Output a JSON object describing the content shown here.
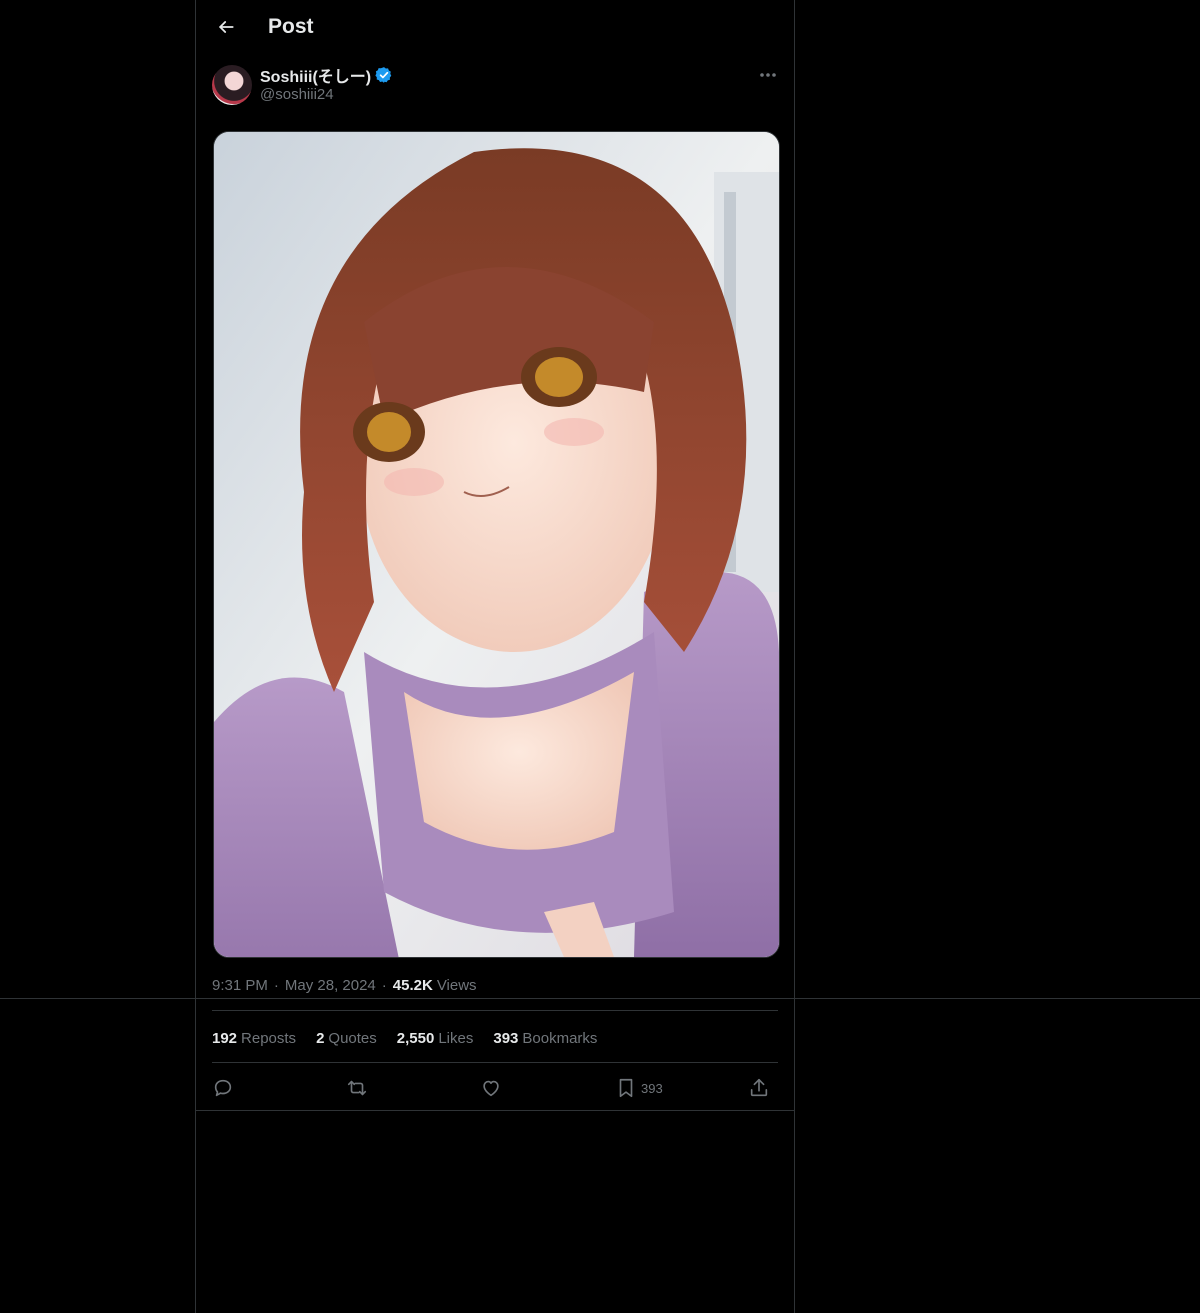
{
  "header": {
    "title": "Post",
    "back_icon": "arrow-left-icon"
  },
  "author": {
    "name": "Soshiii(そしー)",
    "handle": "@soshiii24",
    "verified_icon": "verified-badge-icon",
    "verified_color": "#1d9bf0"
  },
  "post": {
    "media_alt": "Anime illustration of a brown-haired girl in a purple hoodie leaning toward the viewer",
    "time": "9:31 PM",
    "date": "May 28, 2024",
    "views_count": "45.2K",
    "views_label": "Views",
    "separator": "·"
  },
  "stats": {
    "reposts_count": "192",
    "reposts_label": "Reposts",
    "quotes_count": "2",
    "quotes_label": "Quotes",
    "likes_count": "2,550",
    "likes_label": "Likes",
    "bookmarks_count": "393",
    "bookmarks_label": "Bookmarks"
  },
  "actions": {
    "reply_icon": "reply-icon",
    "repost_icon": "repost-icon",
    "like_icon": "heart-icon",
    "bookmark_icon": "bookmark-icon",
    "bookmark_count": "393",
    "share_icon": "share-icon"
  },
  "colors": {
    "background": "#000000",
    "text_primary": "#e7e9ea",
    "text_secondary": "#71767b",
    "border": "#2f3336"
  }
}
